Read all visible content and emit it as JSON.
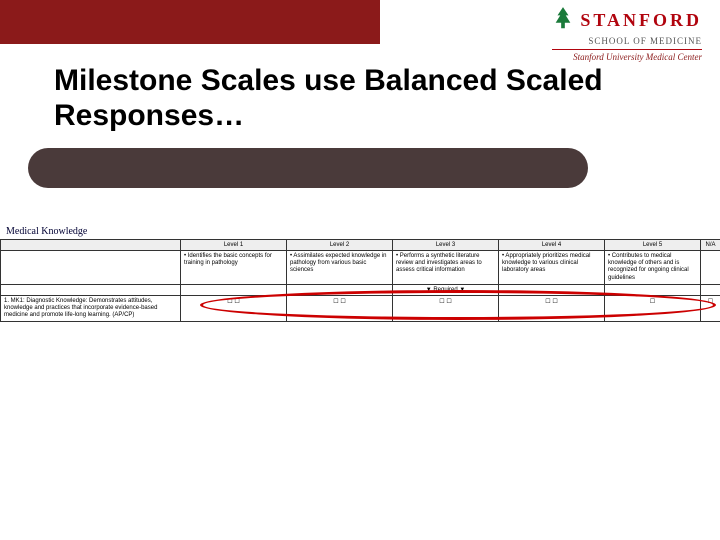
{
  "branding": {
    "university": "STANFORD",
    "school": "SCHOOL OF MEDICINE",
    "tagline": "Stanford University Medical Center"
  },
  "title": "Milestone Scales use Balanced Scaled Responses…",
  "section_header": "Medical Knowledge",
  "levels": [
    "Level 1",
    "Level 2",
    "Level 3",
    "Level 4",
    "Level 5",
    "N/A"
  ],
  "cells": {
    "l1": "• Identifies the basic concepts for training in pathology",
    "l2": "• Assimilates expected knowledge in pathology from various basic sciences",
    "l3": "• Performs a synthetic literature review and investigates areas to assess critical information",
    "l4": "• Appropriately prioritizes medical knowledge to various clinical laboratory areas",
    "l5": "• Contributes to medical knowledge of others and is recognized for ongoing clinical guidelines"
  },
  "caret_label": "▼ Required ▼",
  "item_label": "1. MK1: Diagnostic Knowledge: Demonstrates attitudes, knowledge and practices that incorporate evidence-based medicine and promote life-long learning. (AP/CP)",
  "radio_glyph": "☐"
}
